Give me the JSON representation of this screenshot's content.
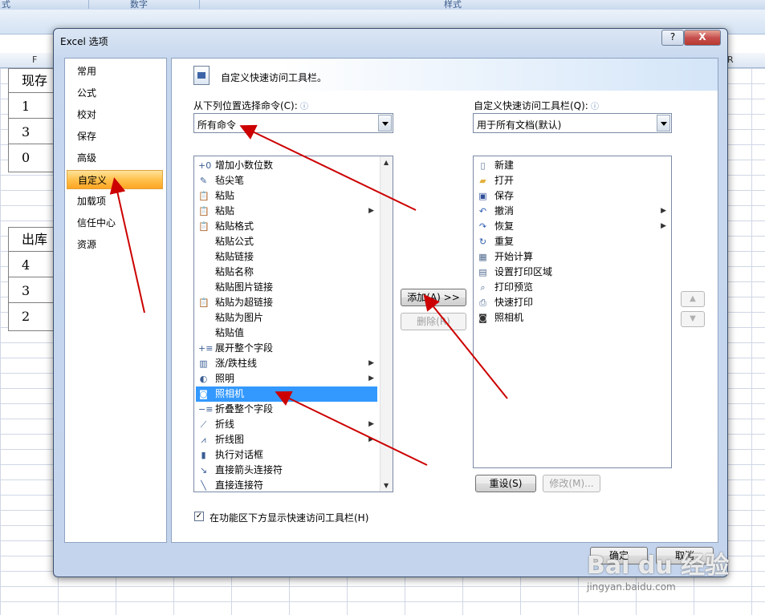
{
  "ribbon": {
    "group_number": "数字",
    "group_style": "样式",
    "left_fragment": "式"
  },
  "sheet": {
    "col_f": "F",
    "col_r": "R",
    "cells_top": [
      "现存",
      "1",
      "3",
      "0"
    ],
    "cells_bottom": [
      "出库",
      "4",
      "3",
      "2"
    ]
  },
  "dialog": {
    "title": "Excel 选项",
    "help": "?",
    "close": "X",
    "nav_items": [
      "常用",
      "公式",
      "校对",
      "保存",
      "高级",
      "自定义",
      "加载项",
      "信任中心",
      "资源"
    ],
    "nav_active_index": 5,
    "banner_title": "自定义快速访问工具栏。",
    "choose_label": "从下列位置选择命令(C):",
    "choose_value": "所有命令",
    "customize_label": "自定义快速访问工具栏(Q):",
    "customize_value": "用于所有文档(默认)",
    "commands": [
      {
        "label": "增加小数位数",
        "icon": "increase-decimal-icon",
        "glyph": "+0"
      },
      {
        "label": "毡尖笔",
        "icon": "felt-pen-icon",
        "glyph": "✎"
      },
      {
        "label": "粘贴",
        "icon": "paste-icon",
        "glyph": "📋"
      },
      {
        "label": "粘贴",
        "icon": "paste-icon",
        "glyph": "📋",
        "submenu": true
      },
      {
        "label": "粘贴格式",
        "icon": "paste-format-icon",
        "glyph": "📋"
      },
      {
        "label": "粘贴公式",
        "icon": "",
        "glyph": ""
      },
      {
        "label": "粘贴链接",
        "icon": "",
        "glyph": ""
      },
      {
        "label": "粘贴名称",
        "icon": "",
        "glyph": ""
      },
      {
        "label": "粘贴图片链接",
        "icon": "",
        "glyph": ""
      },
      {
        "label": "粘贴为超链接",
        "icon": "paste-hyperlink-icon",
        "glyph": "📋"
      },
      {
        "label": "粘贴为图片",
        "icon": "",
        "glyph": ""
      },
      {
        "label": "粘贴值",
        "icon": "",
        "glyph": ""
      },
      {
        "label": "展开整个字段",
        "icon": "expand-field-icon",
        "glyph": "+≡"
      },
      {
        "label": "涨/跌柱线",
        "icon": "updown-bars-icon",
        "glyph": "▥",
        "submenu": true
      },
      {
        "label": "照明",
        "icon": "lighting-icon",
        "glyph": "◐",
        "submenu": true
      },
      {
        "label": "照相机",
        "icon": "camera-icon",
        "glyph": "◙",
        "selected": true
      },
      {
        "label": "折叠整个字段",
        "icon": "collapse-field-icon",
        "glyph": "−≡"
      },
      {
        "label": "折线",
        "icon": "line-icon",
        "glyph": "⟋",
        "submenu": true
      },
      {
        "label": "折线图",
        "icon": "line-chart-icon",
        "glyph": "⩘",
        "submenu": true
      },
      {
        "label": "执行对话框",
        "icon": "run-dialog-icon",
        "glyph": "▮"
      },
      {
        "label": "直接箭头连接符",
        "icon": "arrow-connector-icon",
        "glyph": "↘"
      },
      {
        "label": "直接连接符",
        "icon": "connector-icon",
        "glyph": "╲"
      }
    ],
    "toolbar_items": [
      {
        "label": "新建",
        "icon": "new-doc-icon",
        "glyph": "▯",
        "color": "#5a6f8f"
      },
      {
        "label": "打开",
        "icon": "open-folder-icon",
        "glyph": "▰",
        "color": "#e2b13c"
      },
      {
        "label": "保存",
        "icon": "save-icon",
        "glyph": "▣",
        "color": "#2f4f9a"
      },
      {
        "label": "撤消",
        "icon": "undo-icon",
        "glyph": "↶",
        "color": "#2b5bb0",
        "submenu": true
      },
      {
        "label": "恢复",
        "icon": "redo-icon",
        "glyph": "↷",
        "color": "#2b5bb0",
        "submenu": true
      },
      {
        "label": "重复",
        "icon": "repeat-icon",
        "glyph": "↻",
        "color": "#2b5bb0"
      },
      {
        "label": "开始计算",
        "icon": "calculate-icon",
        "glyph": "▦",
        "color": "#4f6a90"
      },
      {
        "label": "设置打印区域",
        "icon": "print-area-icon",
        "glyph": "▤",
        "color": "#4f6a90"
      },
      {
        "label": "打印预览",
        "icon": "print-preview-icon",
        "glyph": "⌕",
        "color": "#4f6a90"
      },
      {
        "label": "快速打印",
        "icon": "quick-print-icon",
        "glyph": "⎙",
        "color": "#4f6a90"
      },
      {
        "label": "照相机",
        "icon": "camera-icon",
        "glyph": "◙",
        "color": "#333"
      }
    ],
    "add_button": "添加(A) >>",
    "remove_button": "删除(R)",
    "reset_button": "重设(S)",
    "modify_button": "修改(M)...",
    "move_up": "▲",
    "move_down": "▼",
    "show_below_ribbon": "在功能区下方显示快速访问工具栏(H)",
    "show_below_checked": true,
    "ok_button": "确定",
    "cancel_button": "取消"
  },
  "watermark": {
    "logo": "Bai du 经验",
    "url": "jingyan.baidu.com"
  },
  "colors": {
    "selection": "#3399ff",
    "nav_active": "#ffc14d",
    "annotation_arrow": "#cc0000"
  }
}
